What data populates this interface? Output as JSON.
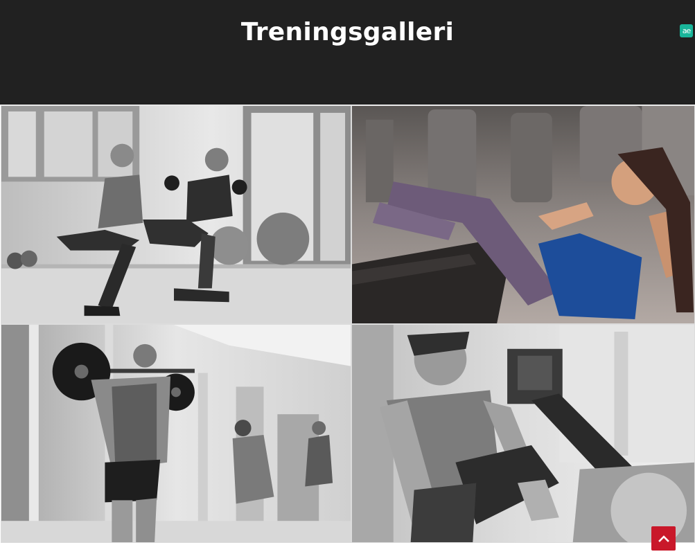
{
  "header": {
    "title": "Treningsgalleri",
    "extension_badge": "ae"
  },
  "gallery": {
    "images": [
      {
        "name": "squat-couple-photo",
        "tone": "grayscale"
      },
      {
        "name": "situp-woman-photo",
        "tone": "color"
      },
      {
        "name": "barbell-man-photo",
        "tone": "grayscale"
      },
      {
        "name": "rowing-woman-photo",
        "tone": "grayscale"
      }
    ]
  },
  "scroll_top": {
    "icon": "chevron-up-icon"
  },
  "colors": {
    "header_bg": "#212121",
    "title_text": "#ffffff",
    "scroll_top_bg": "#c9182a",
    "badge_bg": "#19b59a"
  }
}
